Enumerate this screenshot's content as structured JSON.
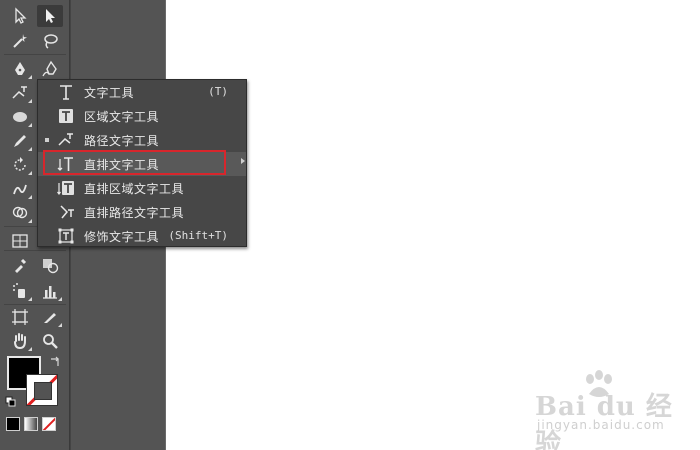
{
  "flyout": {
    "items": [
      {
        "label": "文字工具",
        "shortcut": "(T)",
        "icon": "type-icon"
      },
      {
        "label": "区域文字工具",
        "shortcut": "",
        "icon": "area-type-icon"
      },
      {
        "label": "路径文字工具",
        "shortcut": "",
        "icon": "type-on-path-icon"
      },
      {
        "label": "直排文字工具",
        "shortcut": "",
        "icon": "vertical-type-icon"
      },
      {
        "label": "直排区域文字工具",
        "shortcut": "",
        "icon": "vertical-area-type-icon"
      },
      {
        "label": "直排路径文字工具",
        "shortcut": "",
        "icon": "vertical-type-on-path-icon"
      },
      {
        "label": "修饰文字工具",
        "shortcut": "(Shift+T)",
        "icon": "touch-type-icon"
      }
    ],
    "active_item": "路径文字工具",
    "highlighted_item": "直排文字工具"
  },
  "colors": {
    "panel_bg": "#535353",
    "menu_bg": "#474747",
    "annotation_border": "#d8262c",
    "fill_swatch": "#000000",
    "stroke_swatch": "none"
  },
  "watermark": {
    "main": "Bai du 经验",
    "sub": "jingyan.baidu.com"
  }
}
